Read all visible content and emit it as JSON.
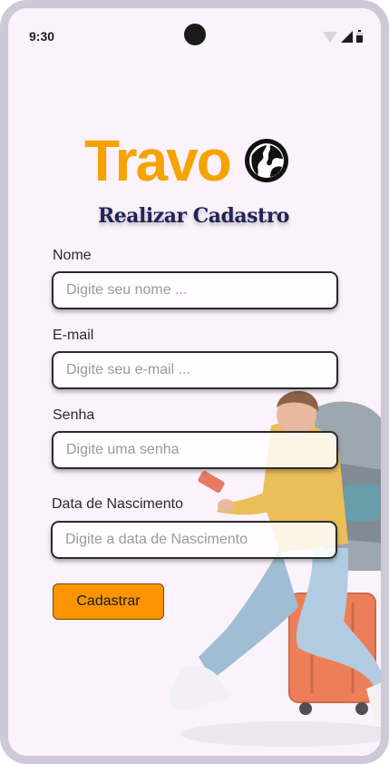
{
  "status_bar": {
    "time": "9:30"
  },
  "brand": {
    "name": "Travo",
    "icon": "globe-icon",
    "color": "#f6a300"
  },
  "page": {
    "title": "Realizar Cadastro"
  },
  "form": {
    "fields": [
      {
        "label": "Nome",
        "placeholder": "Digite seu nome ...",
        "value": ""
      },
      {
        "label": "E-mail",
        "placeholder": "Digite seu e-mail ...",
        "value": ""
      },
      {
        "label": "Senha",
        "placeholder": "Digite uma senha",
        "value": ""
      },
      {
        "label": "Data de Nascimento",
        "placeholder": "Digite a data de Nascimento",
        "value": ""
      }
    ],
    "submit_label": "Cadastrar",
    "submit_color": "#fb9400"
  },
  "colors": {
    "background": "#fcf2fb",
    "title": "#1f2557",
    "frame": "#cfc8d6"
  }
}
